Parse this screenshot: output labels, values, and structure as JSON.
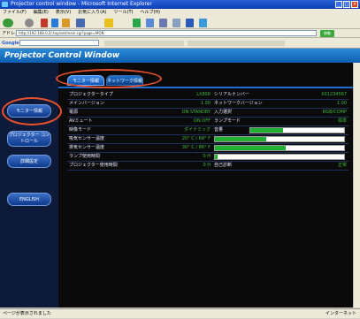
{
  "browser": {
    "title": "Projector control window - Microsoft Internet Explorer",
    "menu": [
      "ファイル(F)",
      "編集(E)",
      "表示(V)",
      "お気に入り(A)",
      "ツール(T)",
      "ヘルプ(H)"
    ],
    "address_label": "アドレス(D)",
    "address": "http://192.168.0.2/.top/set/main.cgi?page=MON",
    "go_label": "移動",
    "google_label": "Google",
    "status_left": "ページが表示されました",
    "status_right": "インターネット"
  },
  "header": {
    "title": "Projector Control Window"
  },
  "sidebar": {
    "items": [
      {
        "label": "モニター情報"
      },
      {
        "label": "プロジェクター コントロール"
      },
      {
        "label": "詳細設定"
      },
      {
        "label": "ENGLISH"
      }
    ]
  },
  "tabs": [
    {
      "label": "モニター情報"
    },
    {
      "label": "ネットワーク情報"
    }
  ],
  "rows": [
    {
      "l1": "プロジェクタータイプ",
      "v1": "LX800",
      "l2": "シリアルナンバー",
      "v2": "X01234567"
    },
    {
      "l1": "メインバージョン",
      "v1": "1.00",
      "l2": "ネットワークバージョン",
      "v2": "1.00"
    },
    {
      "l1": "電源",
      "v1": "ON  STANDBY",
      "l2": "入力選択",
      "v2": "RGB/COMP"
    },
    {
      "l1": "AVミュート",
      "v1": "ON  OFF",
      "l2": "ランプモード",
      "v2": "標準"
    },
    {
      "l1": "映像モード",
      "v1": "ダイナミック",
      "l2": "音量",
      "v2": "20"
    },
    {
      "l1": "吸気センサー温度",
      "v1": "20° C / 68° F",
      "l2": "",
      "v2": ""
    },
    {
      "l1": "排気センサー温度",
      "v1": "30° C / 86° F",
      "l2": "",
      "v2": ""
    },
    {
      "l1": "ランプ使用時間",
      "v1": "0 H",
      "l2": "",
      "v2": ""
    },
    {
      "l1": "プロジェクター使用時間",
      "v1": "0 H",
      "l2": "自己診断",
      "v2": "正常"
    }
  ],
  "bars": {
    "volume": 0.35,
    "intake_temp": 0.4,
    "exhaust_temp": 0.55,
    "lamp_time": 0.02
  },
  "colors": {
    "value_green": "#3fb83f",
    "bar_green": "#22b033",
    "annotation": "#e8502c"
  }
}
